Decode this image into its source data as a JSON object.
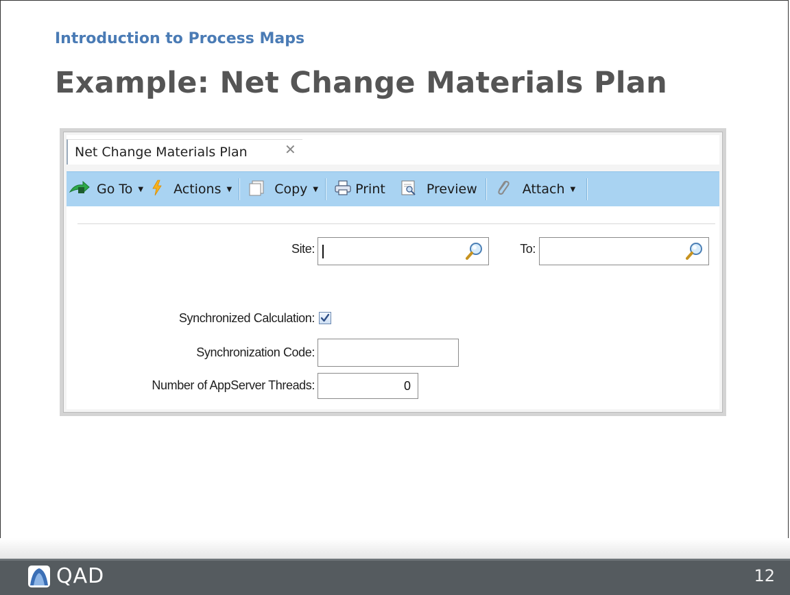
{
  "slide": {
    "subtitle": "Introduction to Process Maps",
    "title": "Example: Net Change Materials Plan",
    "page_number": "12",
    "logo_text": "QAD"
  },
  "app": {
    "tab": {
      "label": "Net Change Materials Plan",
      "close_glyph": "✕"
    },
    "toolbar": {
      "goto_label": "Go To",
      "actions_label": "Actions",
      "copy_label": "Copy",
      "print_label": "Print",
      "preview_label": "Preview",
      "attach_label": "Attach",
      "caret_glyph": "▼"
    },
    "form": {
      "site_label": "Site:",
      "site_value": "",
      "to_label": "To:",
      "to_value": "",
      "sync_calc_label": "Synchronized Calculation:",
      "sync_calc_checked": true,
      "sync_code_label": "Synchronization Code:",
      "sync_code_value": "",
      "threads_label": "Number of AppServer Threads:",
      "threads_value": "0"
    }
  },
  "colors": {
    "toolbar_bg": "#a9d3f2",
    "subtitle": "#4a7bb5",
    "title": "#555555",
    "footer_bg": "#555b5f"
  },
  "icons": {
    "goto": "green-arrow-icon",
    "actions": "lightning-icon",
    "copy": "copy-icon",
    "print": "printer-icon",
    "preview": "preview-icon",
    "attach": "paperclip-icon",
    "lookup": "magnifier-icon",
    "logo": "qad-logo-icon"
  }
}
